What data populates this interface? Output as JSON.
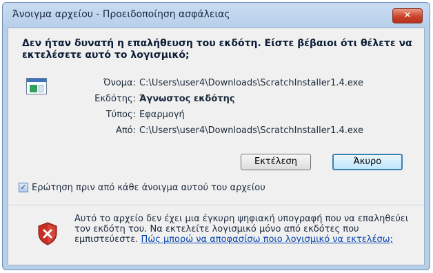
{
  "window": {
    "title": "Άνοιγμα αρχείου - Προειδοποίηση ασφάλειας",
    "close_label": "✕"
  },
  "heading": "Δεν ήταν δυνατή η επαλήθευση του εκδότη. Είστε βέβαιοι ότι θέλετε να εκτελέσετε αυτό το λογισμικό;",
  "details": {
    "name_label": "Όνομα:",
    "name_value": "C:\\Users\\user4\\Downloads\\ScratchInstaller1.4.exe",
    "publisher_label": "Εκδότης:",
    "publisher_value": "Άγνωστος εκδότης",
    "type_label": "Τύπος:",
    "type_value": "Εφαρμογή",
    "from_label": "Από:",
    "from_value": "C:\\Users\\user4\\Downloads\\ScratchInstaller1.4.exe"
  },
  "buttons": {
    "run_label": "Εκτέλεση",
    "cancel_label": "Άκυρο"
  },
  "checkbox": {
    "label": "Ερώτηση πριν από κάθε άνοιγμα αυτού του αρχείου",
    "checked": true
  },
  "warning": {
    "text": "Αυτό το αρχείο δεν έχει μια έγκυρη ψηφιακή υπογραφή που να επαληθεύει τον εκδότη του. Να εκτελείτε λογισμικό μόνο από εκδότες που εμπιστεύεστε.",
    "link": "Πώς μπορώ να αποφασίσω ποιο λογισμικό να εκτελέσω;"
  },
  "icons": {
    "file": "application-window-icon",
    "shield": "security-shield-icon"
  }
}
